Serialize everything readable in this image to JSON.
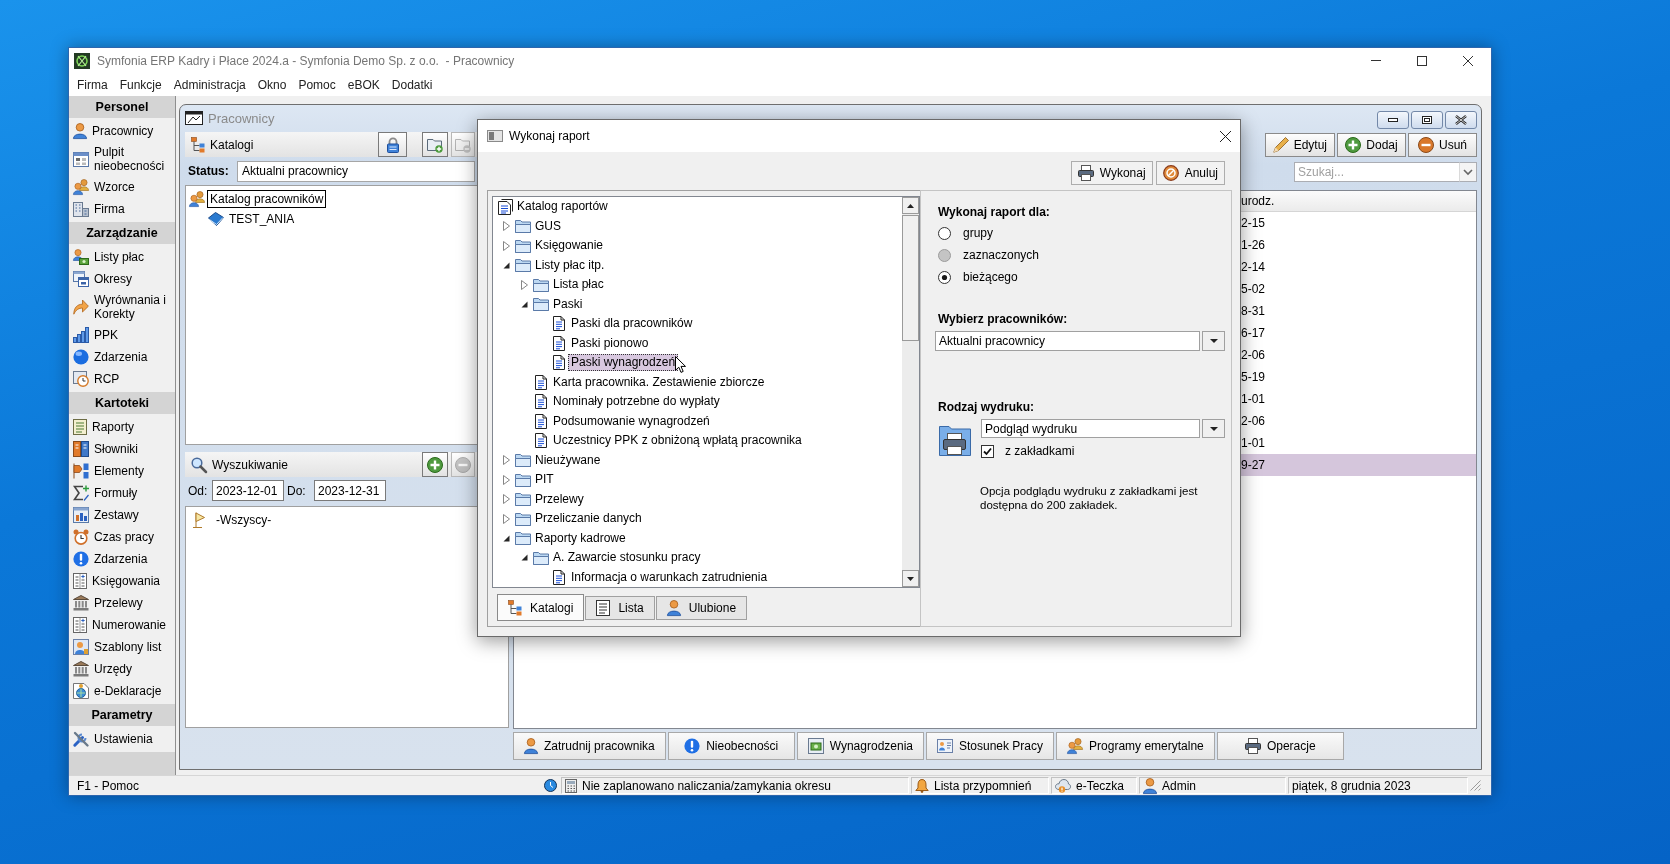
{
  "window": {
    "title": "Symfonia ERP Kadry i Płace 2024.a - Symfonia Demo Sp. z o.o.  - Pracownicy",
    "menu": [
      "Firma",
      "Funkcje",
      "Administracja",
      "Okno",
      "Pomoc",
      "eBOK",
      "Dodatki"
    ]
  },
  "sidebar": {
    "sections": [
      {
        "title": "Personel",
        "items": [
          "Pracownicy",
          "Pulpit nieobecności",
          "Wzorce",
          "Firma"
        ]
      },
      {
        "title": "Zarządzanie",
        "items": [
          "Listy płac",
          "Okresy",
          "Wyrównania i Korekty",
          "PPK",
          "Zdarzenia",
          "RCP"
        ]
      },
      {
        "title": "Kartoteki",
        "items": [
          "Raporty",
          "Słowniki",
          "Elementy",
          "Formuły",
          "Zestawy",
          "Czas pracy",
          "Zdarzenia",
          "Księgowania",
          "Przelewy",
          "Numerowanie",
          "Szablony list",
          "Urzędy",
          "e-Deklaracje"
        ]
      },
      {
        "title": "Parametry",
        "items": [
          "Ustawienia"
        ]
      }
    ]
  },
  "child_window": {
    "title": "Pracownicy"
  },
  "catalog_panel": {
    "title": "Katalogi",
    "buttons": [
      {
        "disabled": false
      },
      {
        "disabled": false
      },
      {
        "disabled": true
      }
    ],
    "status_label": "Status:",
    "status_value": "Aktualni pracownicy",
    "tree": [
      {
        "label": "Katalog pracowników",
        "selected": true,
        "children": [
          {
            "label": "TEST_ANIA",
            "selected": false
          }
        ]
      }
    ]
  },
  "search_panel": {
    "title": "Wyszukiwanie",
    "buttons": [
      {
        "disabled": false
      },
      {
        "disabled": true
      }
    ],
    "from_label": "Od:",
    "from_value": "2023-12-01",
    "to_label": "Do:",
    "to_value": "2023-12-31",
    "items": [
      "-Wszyscy-"
    ]
  },
  "toolbar": {
    "buttons": [
      "Edytuj",
      "Dodaj",
      "Usuń"
    ],
    "search": {
      "placeholder": "Szukaj..."
    }
  },
  "table": {
    "columns": [
      "urodz."
    ],
    "rows": [
      {
        "cells": [
          "2-15"
        ],
        "selected": false
      },
      {
        "cells": [
          "1-26"
        ],
        "selected": false
      },
      {
        "cells": [
          "2-14"
        ],
        "selected": false
      },
      {
        "cells": [
          "5-02"
        ],
        "selected": false
      },
      {
        "cells": [
          "8-31"
        ],
        "selected": false
      },
      {
        "cells": [
          "6-17"
        ],
        "selected": false
      },
      {
        "cells": [
          "2-06"
        ],
        "selected": false
      },
      {
        "cells": [
          "5-19"
        ],
        "selected": false
      },
      {
        "cells": [
          "1-01"
        ],
        "selected": false
      },
      {
        "cells": [
          "2-06"
        ],
        "selected": false
      },
      {
        "cells": [
          "1-01"
        ],
        "selected": false
      },
      {
        "cells": [
          "9-27"
        ],
        "selected": true
      }
    ]
  },
  "action_buttons": [
    "Zatrudnij pracownika",
    "Nieobecności",
    "Wynagrodzenia",
    "Stosunek Pracy",
    "Programy emerytalne",
    "Operacje"
  ],
  "dialog": {
    "title": "Wykonaj raport",
    "buttons": [
      "Wykonaj",
      "Anuluj"
    ],
    "report_tree": {
      "label": "Katalog raportów",
      "kind": "catalog",
      "selected": false,
      "children": [
        {
          "label": "GUS",
          "kind": "folder",
          "expanded": false,
          "selected": false
        },
        {
          "label": "Księgowanie",
          "kind": "folder",
          "expanded": false,
          "selected": false
        },
        {
          "label": "Listy płac itp.",
          "kind": "folder",
          "expanded": true,
          "selected": false,
          "children": [
            {
              "label": "Lista płac",
              "kind": "folder",
              "expanded": false,
              "selected": false
            },
            {
              "label": "Paski",
              "kind": "folder",
              "expanded": true,
              "selected": false,
              "children": [
                {
                  "label": "Paski dla pracowników",
                  "kind": "report",
                  "selected": false
                },
                {
                  "label": "Paski pionowo",
                  "kind": "report",
                  "selected": false
                },
                {
                  "label": "Paski wynagrodzeń",
                  "kind": "report",
                  "selected": true
                }
              ]
            },
            {
              "label": "Karta pracownika. Zestawienie zbiorcze",
              "kind": "report",
              "selected": false
            },
            {
              "label": "Nominały potrzebne do wypłaty",
              "kind": "report",
              "selected": false
            },
            {
              "label": "Podsumowanie wynagrodzeń",
              "kind": "report",
              "selected": false
            },
            {
              "label": "Uczestnicy PPK z obniżoną wpłatą pracownika",
              "kind": "report",
              "selected": false
            }
          ]
        },
        {
          "label": "Nieużywane",
          "kind": "folder",
          "expanded": false,
          "selected": false
        },
        {
          "label": "PIT",
          "kind": "folder",
          "expanded": false,
          "selected": false
        },
        {
          "label": "Przelewy",
          "kind": "folder",
          "expanded": false,
          "selected": false
        },
        {
          "label": "Przeliczanie danych",
          "kind": "folder",
          "expanded": false,
          "selected": false
        },
        {
          "label": "Raporty kadrowe",
          "kind": "folder",
          "expanded": true,
          "selected": false,
          "children": [
            {
              "label": "A. Zawarcie stosunku pracy",
              "kind": "folder",
              "expanded": true,
              "selected": false,
              "children": [
                {
                  "label": "Informacja o warunkach zatrudnienia",
                  "kind": "report",
                  "selected": false
                }
              ]
            }
          ]
        }
      ]
    },
    "tabs": [
      {
        "label": "Katalogi",
        "selected": true
      },
      {
        "label": "Lista",
        "selected": false
      },
      {
        "label": "Ulubione",
        "selected": false
      }
    ],
    "scope": {
      "label": "Wykonaj raport dla:",
      "options": [
        {
          "label": "grupy",
          "selected": false,
          "disabled": false
        },
        {
          "label": "zaznaczonych",
          "selected": false,
          "disabled": true
        },
        {
          "label": "bieżącego",
          "selected": true,
          "disabled": false
        }
      ]
    },
    "employees": {
      "label": "Wybierz pracowników:",
      "value": "Aktualni pracownicy"
    },
    "print": {
      "label": "Rodzaj wydruku:",
      "value": "Podgląd wydruku",
      "bookmarks": {
        "label": "z zakładkami",
        "checked": true
      },
      "note": "Opcja podglądu wydruku z zakładkami jest dostępna do 200 zakładek."
    }
  },
  "status_bar": {
    "help": "F1 - Pomoc",
    "period": "Nie zaplanowano naliczania/zamykania okresu",
    "reminders": "Lista przypomnień",
    "documents": "e-Teczka",
    "user": "Admin",
    "date": "piątek, 8 grudnia 2023"
  }
}
